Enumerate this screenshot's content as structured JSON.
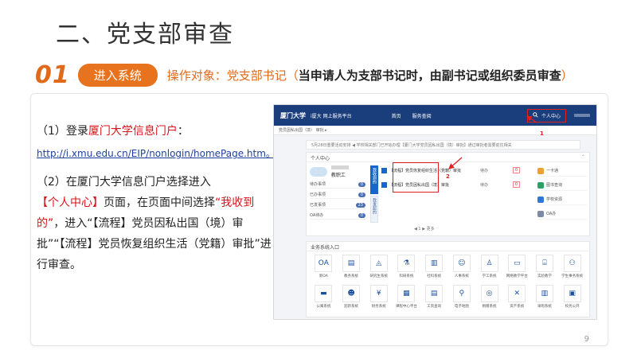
{
  "slide": {
    "title": "二、党支部审查",
    "section_number": "01",
    "section_pill": "进入系统",
    "target_prefix": "操作对象：党支部书记（",
    "target_bold": "当申请人为支部书记时，由副书记或组织委员审查",
    "target_suffix": "）",
    "page_number": "9"
  },
  "instructions": {
    "step1_prefix": "（1）登录",
    "step1_red": "厦门大学信息门户",
    "step1_suffix": "：",
    "step1_link": "http://i.xmu.edu.cn/EIP/nonlogin/homePage.htm。",
    "step2_a": "（2）在厦门大学信息门户选择进入",
    "step2_red1": "【个人中心】",
    "step2_b": "页面，在页面中间选择",
    "step2_red2": "“我收到的”",
    "step2_c": "，进入“【流程】党员因私出国（境）审批”“【流程】党员恢复组织生活（党籍）审批”进行审查。"
  },
  "screenshot": {
    "logo": "厦门大学",
    "platform": "i厦大 网上服务平台",
    "nav": [
      "首页",
      "服务查阅"
    ],
    "personal_center": "个人中心",
    "breadcrumb": "党员因私出国（境） 审批 ▸",
    "notice": "5月28日重要活动安排 ◀ 学校相关部门已开始办理【厦门大学党员因私出国（境）审批】通过审批者需要前往相关",
    "panel_title": "个人中心",
    "user_role": "教职工",
    "menu": [
      {
        "label": "待办事项",
        "count": "0"
      },
      {
        "label": "已办事项",
        "count": "0"
      },
      {
        "label": "已发事项",
        "count": "23"
      },
      {
        "label": "OA待办",
        "count": "0"
      }
    ],
    "vertical_tabs": [
      "我收到的",
      "我发起的"
    ],
    "tasks": [
      "【流程】党员恢复组织生活（党籍）审批",
      "【流程】党员因私出国（境）审批"
    ],
    "task_counts": [
      {
        "label": "待办",
        "n": "0"
      },
      {
        "label": "待办",
        "n": "0"
      }
    ],
    "pager": "◀ 1 ▶   更多",
    "tools": [
      "一卡通",
      "图书查询",
      "学校资源",
      "OA办"
    ],
    "annotation_1": "1",
    "annotation_2": "2",
    "entry_title": "业务系统入口",
    "systems_row1": [
      "新OA",
      "教务系统",
      "研究生系统",
      "科研系统",
      "社科系统",
      "人事系统",
      "学工系统",
      "网络教学平台",
      "实验教学",
      "学生事务系统"
    ],
    "systems_row2": [
      "公寓系统",
      "迎新系统",
      "财务系统",
      "课程中心平台",
      "工资查询",
      "电子地图",
      "捐赠系统",
      "资产系统",
      "采购系统",
      "校务公开"
    ]
  },
  "colors": {
    "accent": "#e8731e",
    "link": "#1f3f9e",
    "highlight": "#d9151c",
    "navbar": "#1a3d7c"
  }
}
